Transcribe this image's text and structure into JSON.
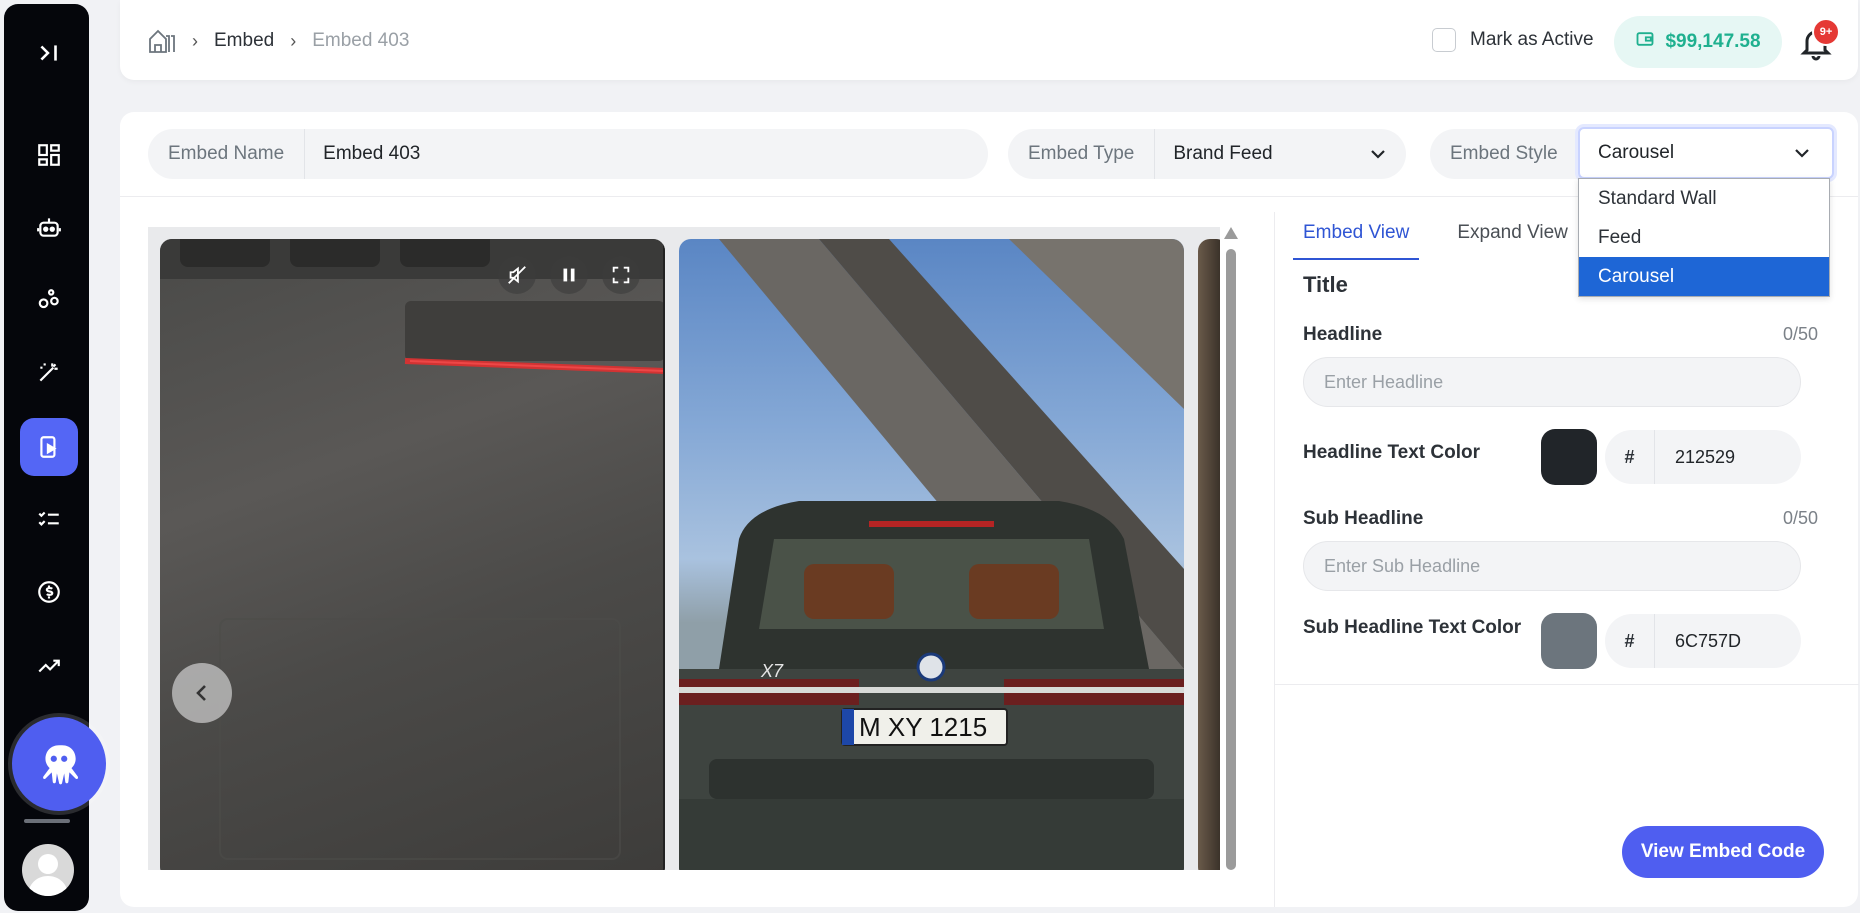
{
  "breadcrumb": {
    "section": "Embed",
    "current": "Embed 403"
  },
  "header": {
    "mark_active_label": "Mark as Active",
    "balance": "$99,147.58",
    "notification_badge": "9+"
  },
  "form": {
    "name_label": "Embed Name",
    "name_value": "Embed 403",
    "type_label": "Embed Type",
    "type_value": "Brand Feed",
    "style_label": "Embed Style",
    "style_value": "Carousel",
    "style_options": [
      "Standard Wall",
      "Feed",
      "Carousel"
    ]
  },
  "tabs": [
    "Embed View",
    "Expand View"
  ],
  "settings": {
    "section_title": "Title",
    "headline_label": "Headline",
    "headline_counter": "0/50",
    "headline_placeholder": "Enter Headline",
    "headline_color_label": "Headline Text Color",
    "headline_color_hash": "#",
    "headline_color_value": "212529",
    "sub_headline_label": "Sub Headline",
    "sub_headline_counter": "0/50",
    "sub_headline_placeholder": "Enter Sub Headline",
    "sub_headline_color_label": "Sub Headline Text Color",
    "sub_headline_color_hash": "#",
    "sub_headline_color_value": "6C757D"
  },
  "actions": {
    "view_embed_code": "View Embed Code"
  },
  "car_plate": "M XY 1215",
  "car_badge": "X7",
  "colors": {
    "accent": "#4f5ef0",
    "headline_swatch": "#212529",
    "sub_headline_swatch": "#6c757d",
    "balance_green": "#1fb08f",
    "selected_option": "#1e66d6"
  }
}
